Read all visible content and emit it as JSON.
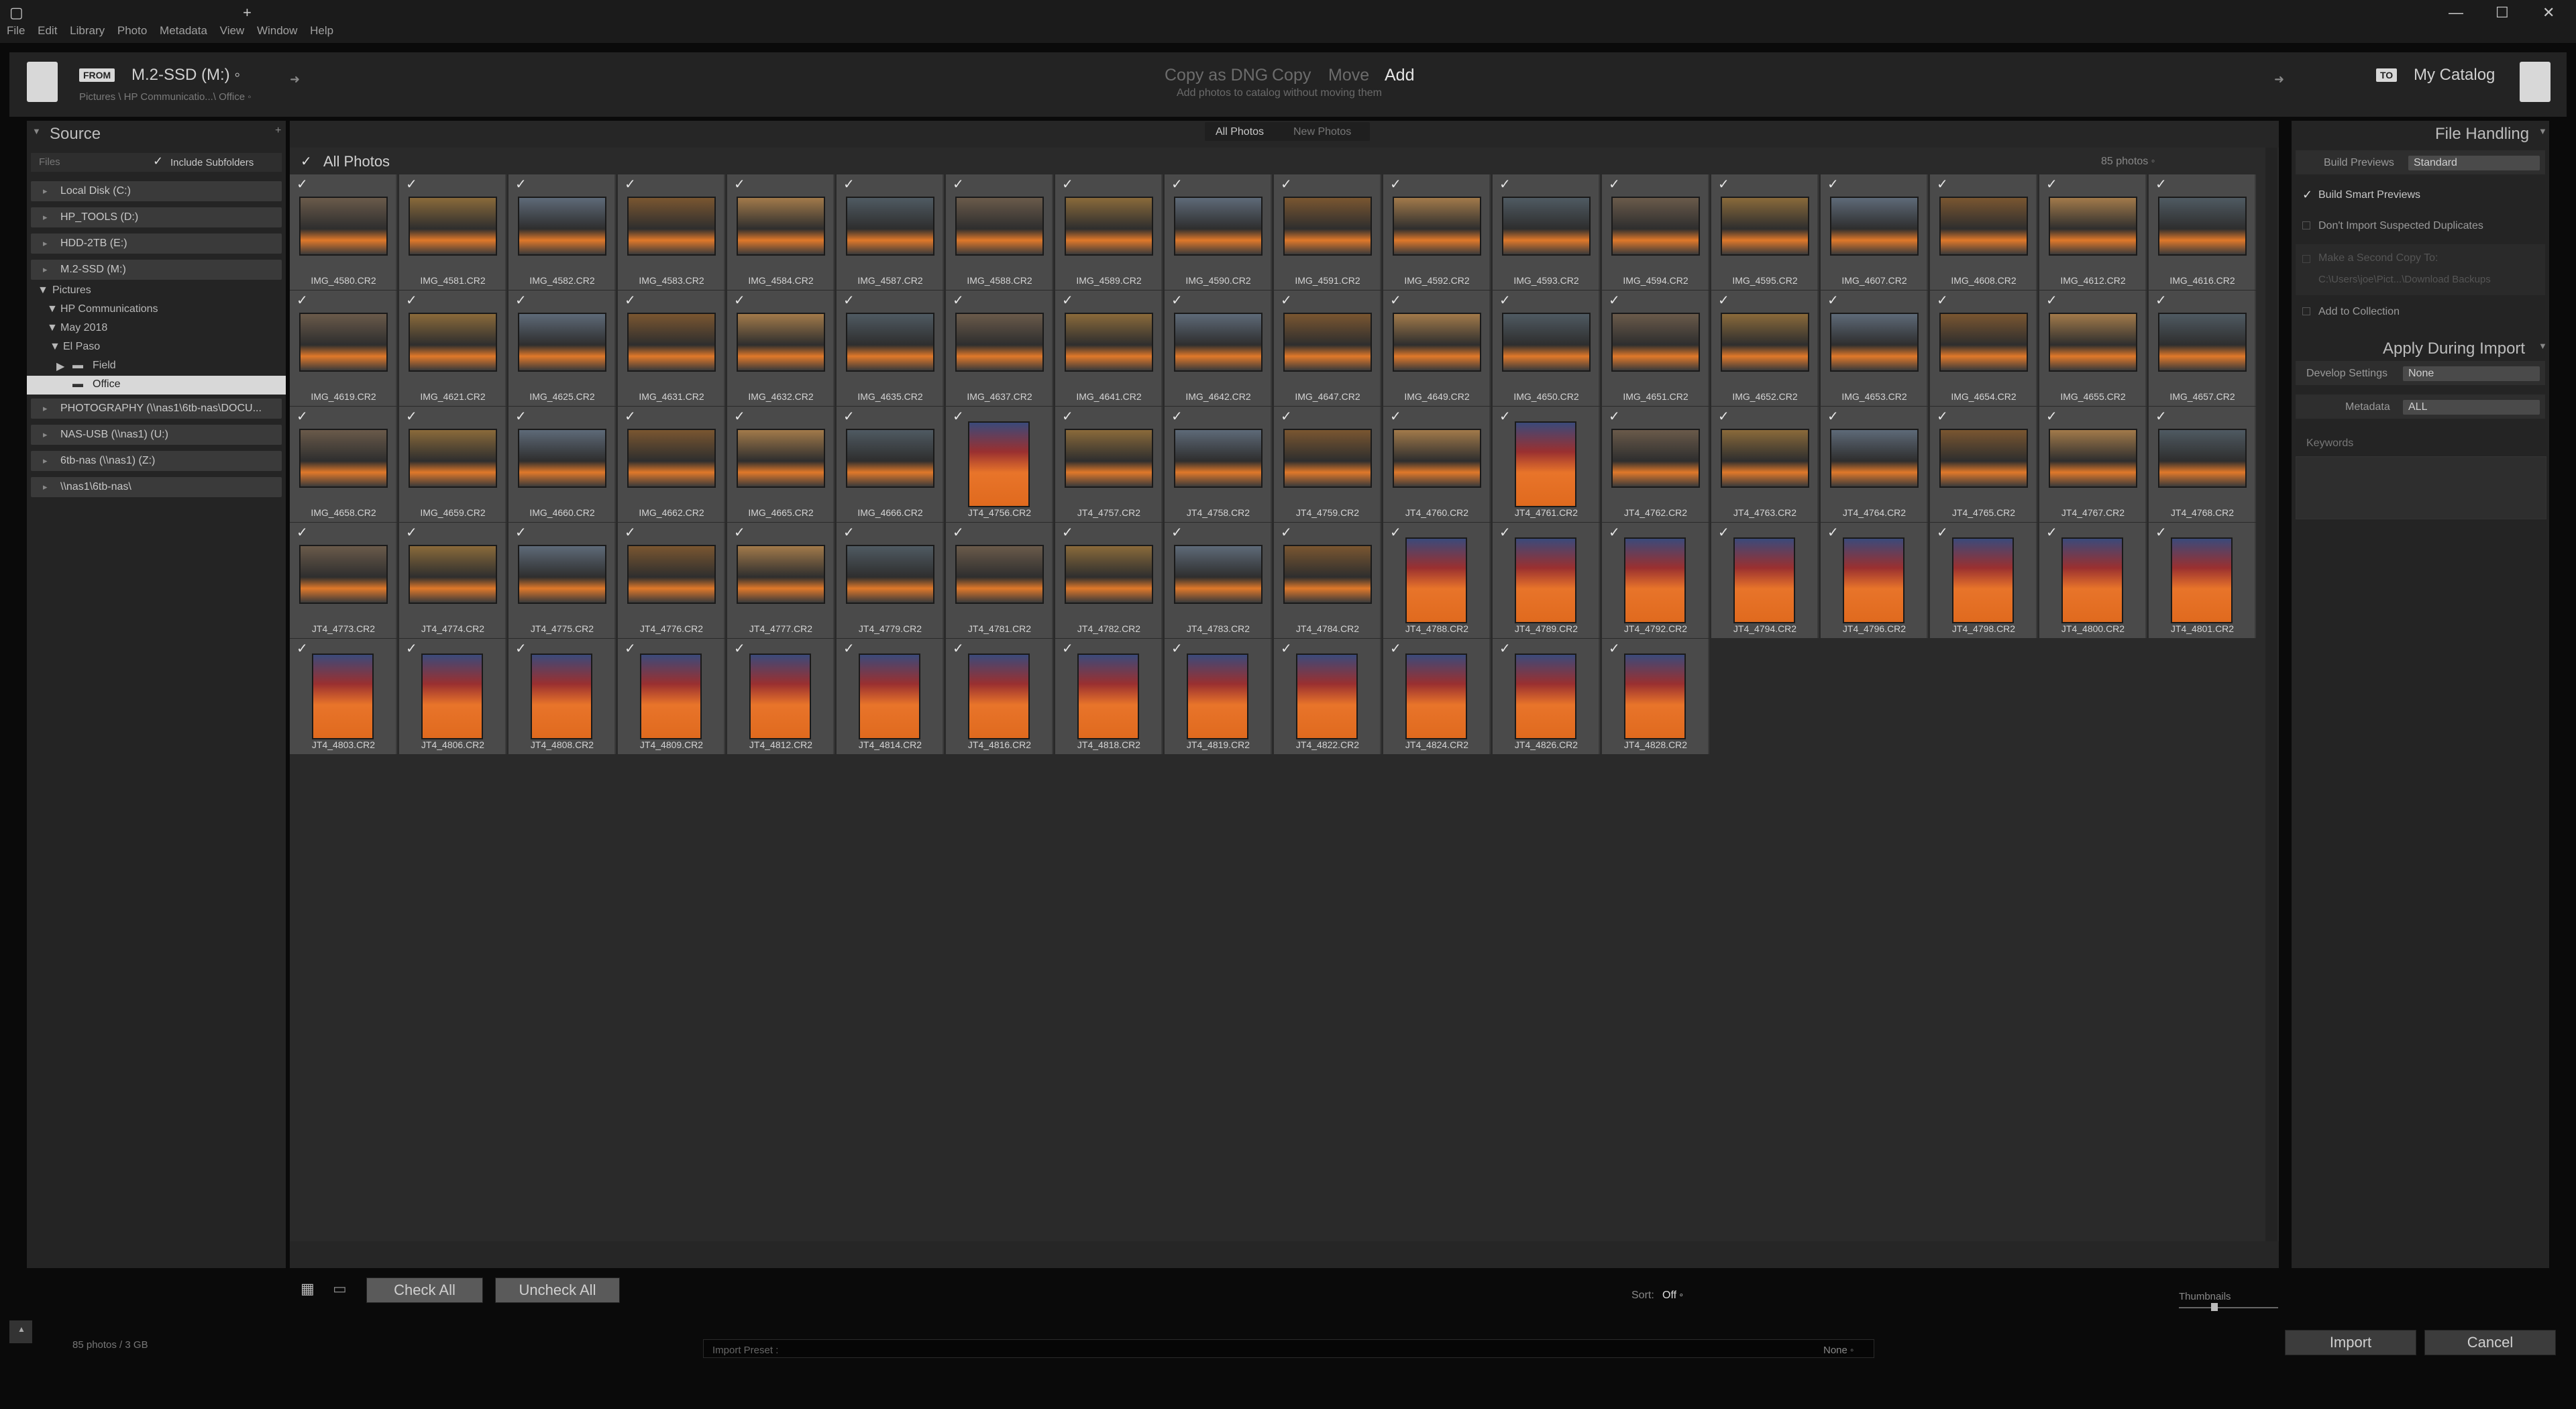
{
  "menu": [
    "File",
    "Edit",
    "Library",
    "Photo",
    "Metadata",
    "View",
    "Window",
    "Help"
  ],
  "header": {
    "from_badge": "FROM",
    "from_volume": "M.2-SSD (M:) ◦",
    "from_path": "Pictures \\ HP Communicatio...\\ Office ◦",
    "modes": [
      "Copy as DNG",
      "Copy",
      "Move",
      "Add"
    ],
    "active_mode": "Add",
    "mode_desc": "Add photos to catalog without moving them",
    "to_badge": "TO",
    "to_name": "My Catalog"
  },
  "source": {
    "title": "Source",
    "files_label": "Files",
    "include_subfolders": "Include Subfolders",
    "devices_top": [
      "Local Disk (C:)",
      "HP_TOOLS (D:)",
      "HDD-2TB (E:)",
      "M.2-SSD (M:)"
    ],
    "tree": [
      "Pictures",
      "HP Communications",
      "May 2018",
      "El Paso",
      "Field",
      "Office"
    ],
    "devices_bottom": [
      "PHOTOGRAPHY (\\\\nas1\\6tb-nas\\DOCU...",
      "NAS-USB (\\\\nas1) (U:)",
      "6tb-nas (\\\\nas1) (Z:)",
      "\\\\nas1\\6tb-nas\\"
    ]
  },
  "center": {
    "tabs": [
      "All Photos",
      "New Photos"
    ],
    "grid_title": "All Photos",
    "photo_count": "85 photos ◦",
    "photos": [
      "IMG_4580.CR2",
      "IMG_4581.CR2",
      "IMG_4582.CR2",
      "IMG_4583.CR2",
      "IMG_4584.CR2",
      "IMG_4587.CR2",
      "IMG_4588.CR2",
      "IMG_4589.CR2",
      "IMG_4590.CR2",
      "IMG_4591.CR2",
      "IMG_4592.CR2",
      "IMG_4593.CR2",
      "IMG_4594.CR2",
      "IMG_4595.CR2",
      "IMG_4607.CR2",
      "IMG_4608.CR2",
      "IMG_4612.CR2",
      "IMG_4616.CR2",
      "IMG_4619.CR2",
      "IMG_4621.CR2",
      "IMG_4625.CR2",
      "IMG_4631.CR2",
      "IMG_4632.CR2",
      "IMG_4635.CR2",
      "IMG_4637.CR2",
      "IMG_4641.CR2",
      "IMG_4642.CR2",
      "IMG_4647.CR2",
      "IMG_4649.CR2",
      "IMG_4650.CR2",
      "IMG_4651.CR2",
      "IMG_4652.CR2",
      "IMG_4653.CR2",
      "IMG_4654.CR2",
      "IMG_4655.CR2",
      "IMG_4657.CR2",
      "IMG_4658.CR2",
      "IMG_4659.CR2",
      "IMG_4660.CR2",
      "IMG_4662.CR2",
      "IMG_4665.CR2",
      "IMG_4666.CR2",
      "JT4_4756.CR2",
      "JT4_4757.CR2",
      "JT4_4758.CR2",
      "JT4_4759.CR2",
      "JT4_4760.CR2",
      "JT4_4761.CR2",
      "JT4_4762.CR2",
      "JT4_4763.CR2",
      "JT4_4764.CR2",
      "JT4_4765.CR2",
      "JT4_4767.CR2",
      "JT4_4768.CR2",
      "JT4_4773.CR2",
      "JT4_4774.CR2",
      "JT4_4775.CR2",
      "JT4_4776.CR2",
      "JT4_4777.CR2",
      "JT4_4779.CR2",
      "JT4_4781.CR2",
      "JT4_4782.CR2",
      "JT4_4783.CR2",
      "JT4_4784.CR2",
      "JT4_4788.CR2",
      "JT4_4789.CR2",
      "JT4_4792.CR2",
      "JT4_4794.CR2",
      "JT4_4796.CR2",
      "JT4_4798.CR2",
      "JT4_4800.CR2",
      "JT4_4801.CR2",
      "JT4_4803.CR2",
      "JT4_4806.CR2",
      "JT4_4808.CR2",
      "JT4_4809.CR2",
      "JT4_4812.CR2",
      "JT4_4814.CR2",
      "JT4_4816.CR2",
      "JT4_4818.CR2",
      "JT4_4819.CR2",
      "JT4_4822.CR2",
      "JT4_4824.CR2",
      "JT4_4826.CR2",
      "JT4_4828.CR2"
    ],
    "check_all": "Check All",
    "uncheck_all": "Uncheck All",
    "sort_label": "Sort:",
    "sort_value": "Off ◦",
    "thumbnails_label": "Thumbnails"
  },
  "file_handling": {
    "title": "File Handling",
    "build_previews_label": "Build Previews",
    "build_previews_value": "Standard",
    "build_smart": "Build Smart Previews",
    "dont_import": "Don't Import Suspected Duplicates",
    "second_copy": "Make a Second Copy To:",
    "second_copy_path": "C:\\Users\\joe\\Pict...\\Download Backups",
    "add_collection": "Add to Collection"
  },
  "apply_import": {
    "title": "Apply During Import",
    "develop_label": "Develop Settings",
    "develop_value": "None",
    "metadata_label": "Metadata",
    "metadata_value": "ALL",
    "keywords_label": "Keywords"
  },
  "footer": {
    "summary": "85 photos / 3 GB",
    "import_preset": "Import Preset :",
    "preset_value": "None ◦",
    "import": "Import",
    "cancel": "Cancel"
  }
}
